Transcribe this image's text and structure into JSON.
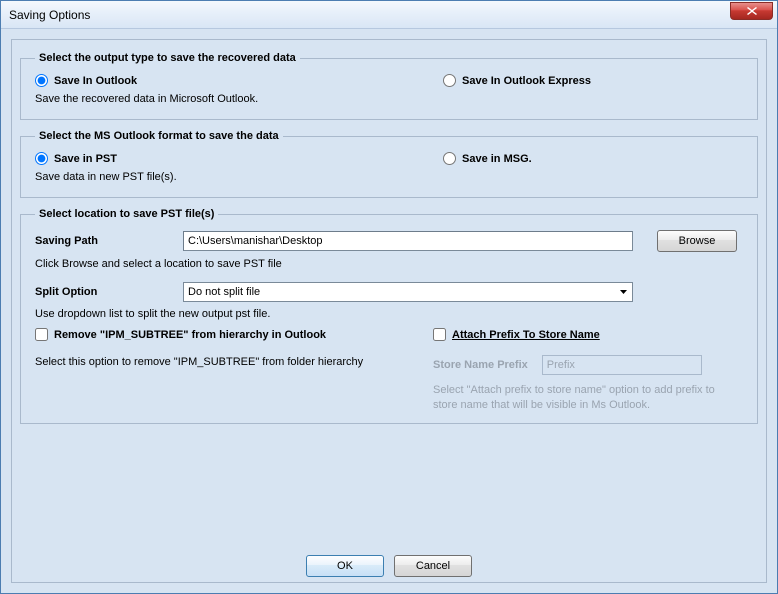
{
  "window": {
    "title": "Saving Options"
  },
  "group1": {
    "legend": "Select the output type to save the recovered data",
    "opt1_label": "Save In Outlook",
    "opt2_label": "Save In Outlook Express",
    "desc": "Save the recovered data in Microsoft Outlook."
  },
  "group2": {
    "legend": "Select the MS Outlook format to save the data",
    "opt1_label": "Save in PST",
    "opt2_label": "Save in MSG.",
    "desc": "Save data in new PST file(s)."
  },
  "group3": {
    "legend": "Select location to save PST file(s)",
    "path_label": "Saving Path",
    "path_value": "C:\\Users\\manishar\\Desktop",
    "browse_label": "Browse",
    "path_hint": "Click Browse and select a location to save PST file",
    "split_label": "Split Option",
    "split_value": "Do not split file",
    "split_hint": "Use dropdown list to split the new output pst file.",
    "remove_label": "Remove \"IPM_SUBTREE\" from hierarchy in Outlook",
    "remove_desc": "Select this option to remove \"IPM_SUBTREE\" from folder hierarchy",
    "prefix_label": "Attach Prefix To Store Name",
    "store_label": "Store Name Prefix",
    "store_placeholder": "Prefix",
    "store_hint": "Select \"Attach prefix to store name\" option to add prefix to store name that will be visible in Ms Outlook."
  },
  "buttons": {
    "ok": "OK",
    "cancel": "Cancel"
  }
}
